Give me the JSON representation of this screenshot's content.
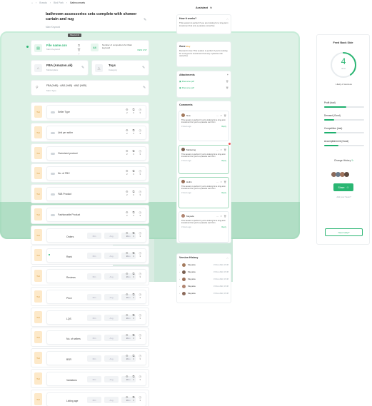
{
  "breadcrumb": [
    "Brands",
    "Bird Park",
    "Bathroomsets"
  ],
  "breadcrumb_home": "home-icon",
  "product": {
    "title": "bathroom accessories sets complete with shower curtain and rug",
    "title_sub": "Main Keyword"
  },
  "tooltip": "Sheets Info",
  "file_card": {
    "name": "File name.csv",
    "sub": "Main Keyword",
    "count": "44",
    "count_label": "Number of competitors for Main keyword",
    "link": "VIEW LIST"
  },
  "fba_card": {
    "title": "FBA (Amazon.uk)",
    "sub": "Marketplace"
  },
  "toys_card": {
    "title": "Toys",
    "sub": "Category"
  },
  "fba_line": {
    "values": "FBA (%45) · AAD (%45) · AAD (%55)",
    "sub": "Main Type"
  },
  "rows": [
    {
      "tag": "Ts4",
      "label": "Seller Type",
      "counts": [
        "2",
        "3",
        "3"
      ],
      "type": "toggle"
    },
    {
      "tag": "Ts4",
      "label": "Unit per seller",
      "counts": [
        "2",
        "3",
        "3"
      ],
      "type": "toggle"
    },
    {
      "tag": "Ts4",
      "label": "Oversized product",
      "counts": [
        "2",
        "3",
        "3"
      ],
      "type": "toggle"
    },
    {
      "tag": "Ts4",
      "label": "No. of FBC",
      "counts": [
        "2",
        "3",
        "3"
      ],
      "type": "toggle"
    },
    {
      "tag": "Ts4",
      "label": "FAB Product",
      "counts": [
        "2",
        "3",
        "3"
      ],
      "type": "toggle"
    },
    {
      "tag": "Ts4",
      "label": "Fashionable Product",
      "counts": [
        "2",
        "3",
        "3"
      ],
      "type": "toggle"
    },
    {
      "tag": "Ts4",
      "label": "Orders",
      "counts": [
        "2",
        "3",
        "3"
      ],
      "type": "pills"
    },
    {
      "tag": "Ts4",
      "label": "Rank",
      "counts": [
        "2",
        "3",
        "3"
      ],
      "type": "pills"
    },
    {
      "tag": "Ts4",
      "label": "Reviews",
      "counts": [
        "2",
        "3",
        "3"
      ],
      "type": "pills"
    },
    {
      "tag": "Ts4",
      "label": "Price",
      "counts": [
        "2",
        "3",
        "3"
      ],
      "type": "pills"
    },
    {
      "tag": "Ts4",
      "label": "LQS",
      "counts": [
        "2",
        "3",
        "3"
      ],
      "type": "pills"
    },
    {
      "tag": "Ts4",
      "label": "No. of sellers",
      "counts": [
        "2",
        "3",
        "3"
      ],
      "type": "pills"
    },
    {
      "tag": "Ts4",
      "label": "BSR",
      "counts": [
        "2",
        "3",
        "3"
      ],
      "type": "pills"
    },
    {
      "tag": "Ts4",
      "label": "Variations",
      "counts": [
        "2",
        "3",
        "3"
      ],
      "type": "pills"
    },
    {
      "tag": "Ts4",
      "label": "Listing age",
      "counts": [
        "2",
        "3",
        "3"
      ],
      "type": "pills"
    }
  ],
  "pill_labels": [
    "Min",
    "Avg",
    "Max"
  ],
  "assistant": {
    "title": "Assistant",
    "how_title": "How it works?",
    "how_text": "This session is perfect if you are looking for a long-term investment but only a passive ownerhse",
    "zone_title": "Zone",
    "zone_badge": "Buy",
    "zone_text": "Demand is low. This session is perfect if you're looking for a long-term investment but only a passive risk ownerhse",
    "attachments_title": "Attachments",
    "attachments": [
      "Filename.pdf",
      "Filename.pdf"
    ],
    "comments_title": "Comments",
    "comments": [
      {
        "name": "Noa",
        "text": "This session is perfect if you're looking for a long-term investment but you're a passive own form",
        "time": "3 hours ago",
        "reply": "Reply"
      },
      {
        "name": "Marketing",
        "text": "This session is perfect if you're looking for a long-term investment but you're a passive own form",
        "time": "3 hours ago",
        "reply": "Reply"
      },
      {
        "name": "Hoilin",
        "text": "This session is perfect if you're looking for a long-term investment but you're a passive own form",
        "time": "3 hours ago",
        "reply": "Reply"
      },
      {
        "name": "Meyada",
        "text": "This session is perfect if you're looking for a long-term investment but you're a passive own form",
        "time": "3 hours ago",
        "reply": "Reply"
      }
    ],
    "version_title": "Version History",
    "versions": [
      {
        "name": "Meyada",
        "date": "15 Nov 2022, 15:38"
      },
      {
        "name": "Meyada",
        "date": "15 Nov 2022, 15:38"
      },
      {
        "name": "Meyada",
        "date": "15 Nov 2022, 15:38"
      },
      {
        "name": "Meyada",
        "date": "15 Nov 2022, 15:38"
      },
      {
        "name": "Meyada",
        "date": "15 Nov 2022, 15:38"
      }
    ]
  },
  "feedback": {
    "title": "Feed Back Side",
    "score": "4",
    "score_sub": "of 10",
    "score_label": "Likely of success",
    "score_fraction": 0.4,
    "metrics": [
      {
        "label": "Profit (bad)",
        "value": 0.55
      },
      {
        "label": "Demand (Good)",
        "value": 0.25
      },
      {
        "label": "Competition (bad)",
        "value": 0.3
      },
      {
        "label": "Accomplishment (Good)",
        "value": 0.35
      }
    ],
    "change_history": "Change History",
    "share_label": "Share",
    "add_user": "Add your Team?",
    "need_help": "Need Help?"
  },
  "colors": {
    "accent": "#2bb673",
    "tag_bg": "#fde9c9",
    "overlay": "#b4e1c8"
  }
}
